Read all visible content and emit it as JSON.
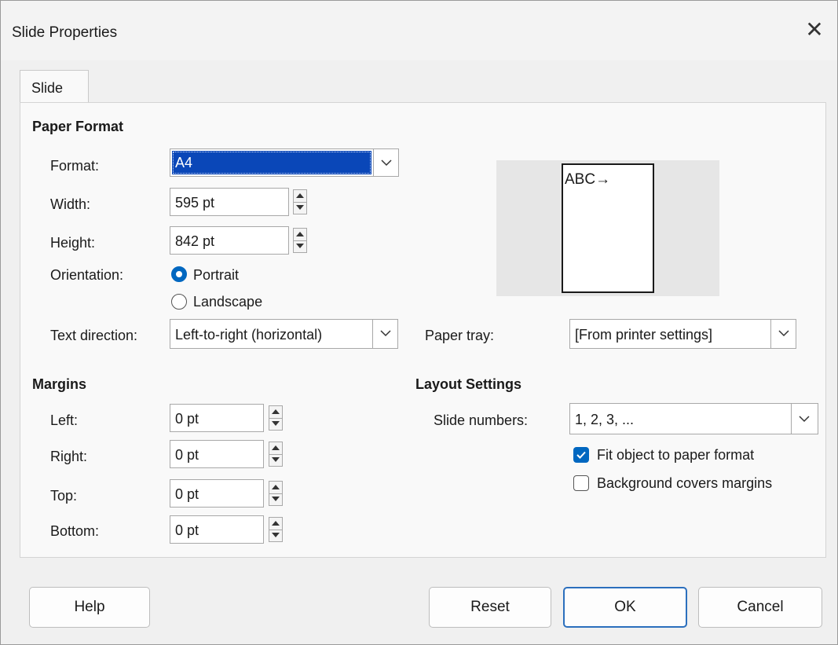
{
  "window": {
    "title": "Slide Properties",
    "close_glyph": "✕"
  },
  "tabs": [
    {
      "label": "Slide",
      "active": true
    }
  ],
  "paper_format": {
    "heading": "Paper Format",
    "format_label": "Format:",
    "format_value": "A4",
    "width_label": "Width:",
    "width_value": "595 pt",
    "height_label": "Height:",
    "height_value": "842 pt",
    "orientation_label": "Orientation:",
    "orientation_options": [
      {
        "label": "Portrait",
        "selected": true
      },
      {
        "label": "Landscape",
        "selected": false
      }
    ],
    "text_direction_label": "Text direction:",
    "text_direction_value": "Left-to-right (horizontal)",
    "paper_tray_label": "Paper tray:",
    "paper_tray_value": "[From printer settings]",
    "preview_text": "ABC→"
  },
  "margins": {
    "heading": "Margins",
    "left_label": "Left:",
    "left_value": "0 pt",
    "right_label": "Right:",
    "right_value": "0 pt",
    "top_label": "Top:",
    "top_value": "0 pt",
    "bottom_label": "Bottom:",
    "bottom_value": "0 pt"
  },
  "layout_settings": {
    "heading": "Layout Settings",
    "slide_numbers_label": "Slide numbers:",
    "slide_numbers_value": "1, 2, 3, ...",
    "fit_object_label": "Fit object to paper format",
    "fit_object_checked": true,
    "background_covers_label": "Background covers margins",
    "background_covers_checked": false
  },
  "buttons": {
    "help": "Help",
    "reset": "Reset",
    "ok": "OK",
    "cancel": "Cancel"
  },
  "colors": {
    "accent": "#0067c0",
    "selection": "#0a47b8",
    "default_button_border": "#2b6fbd"
  }
}
